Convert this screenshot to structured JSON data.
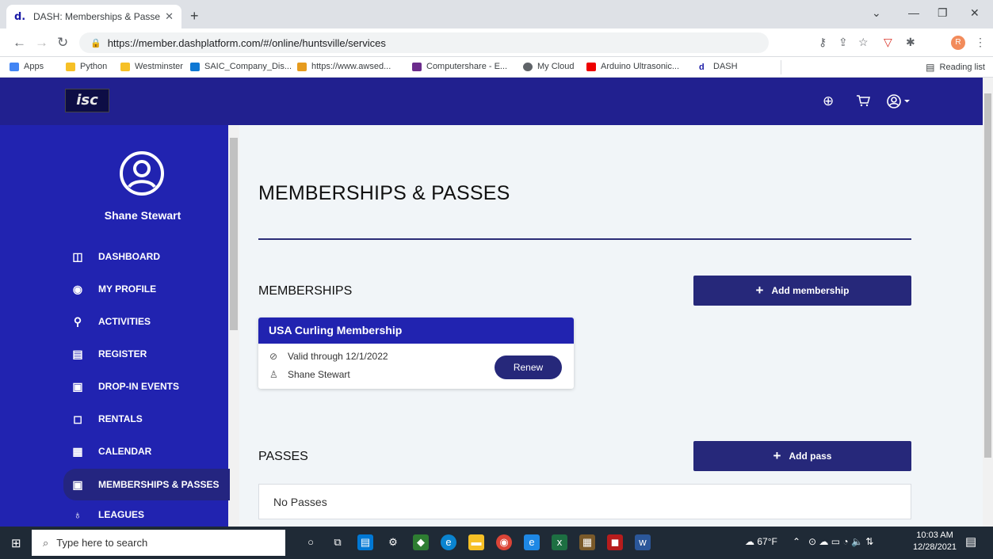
{
  "browser": {
    "tab_title": "DASH: Memberships & Passes",
    "tab_favicon": "d.",
    "close_glyph": "✕",
    "new_tab_glyph": "+",
    "url": "https://member.dashplatform.com/#/online/huntsville/services",
    "profile_initial": "R",
    "bookmarks": [
      "Apps",
      "Python",
      "Westminster",
      "SAIC_Company_Dis...",
      "https://www.awsed...",
      "Computershare - E...",
      "My Cloud",
      "Arduino Ultrasonic...",
      "DASH"
    ],
    "reading_list": "Reading list"
  },
  "header": {
    "logo_text": "isc",
    "icons": [
      "globe-icon",
      "cart-icon",
      "account-menu-icon"
    ]
  },
  "sidebar": {
    "user_name": "Shane Stewart",
    "items": [
      {
        "label": "DASHBOARD",
        "icon": "dashboard-icon"
      },
      {
        "label": "MY PROFILE",
        "icon": "profile-icon"
      },
      {
        "label": "ACTIVITIES",
        "icon": "activities-icon"
      },
      {
        "label": "REGISTER",
        "icon": "register-icon"
      },
      {
        "label": "DROP-IN EVENTS",
        "icon": "dropin-icon"
      },
      {
        "label": "RENTALS",
        "icon": "rentals-icon"
      },
      {
        "label": "CALENDAR",
        "icon": "calendar-icon"
      },
      {
        "label": "MEMBERSHIPS & PASSES",
        "icon": "memberships-icon",
        "active": true
      },
      {
        "label": "LEAGUES",
        "icon": "leagues-icon"
      }
    ]
  },
  "main": {
    "page_title": "MEMBERSHIPS & PASSES",
    "memberships_heading": "MEMBERSHIPS",
    "add_membership_label": "Add membership",
    "membership_card": {
      "title": "USA Curling Membership",
      "valid_text": "Valid through 12/1/2022",
      "holder": "Shane Stewart",
      "renew_label": "Renew"
    },
    "passes_heading": "PASSES",
    "add_pass_label": "Add pass",
    "no_passes_text": "No Passes"
  },
  "taskbar": {
    "search_placeholder": "Type here to search",
    "weather": "67°F",
    "time": "10:03 AM",
    "date": "12/28/2021"
  },
  "colors": {
    "header_bg": "#21208f",
    "sidebar_bg": "#2123b0",
    "button_bg": "#26287a",
    "main_bg": "#f1f5f8"
  }
}
